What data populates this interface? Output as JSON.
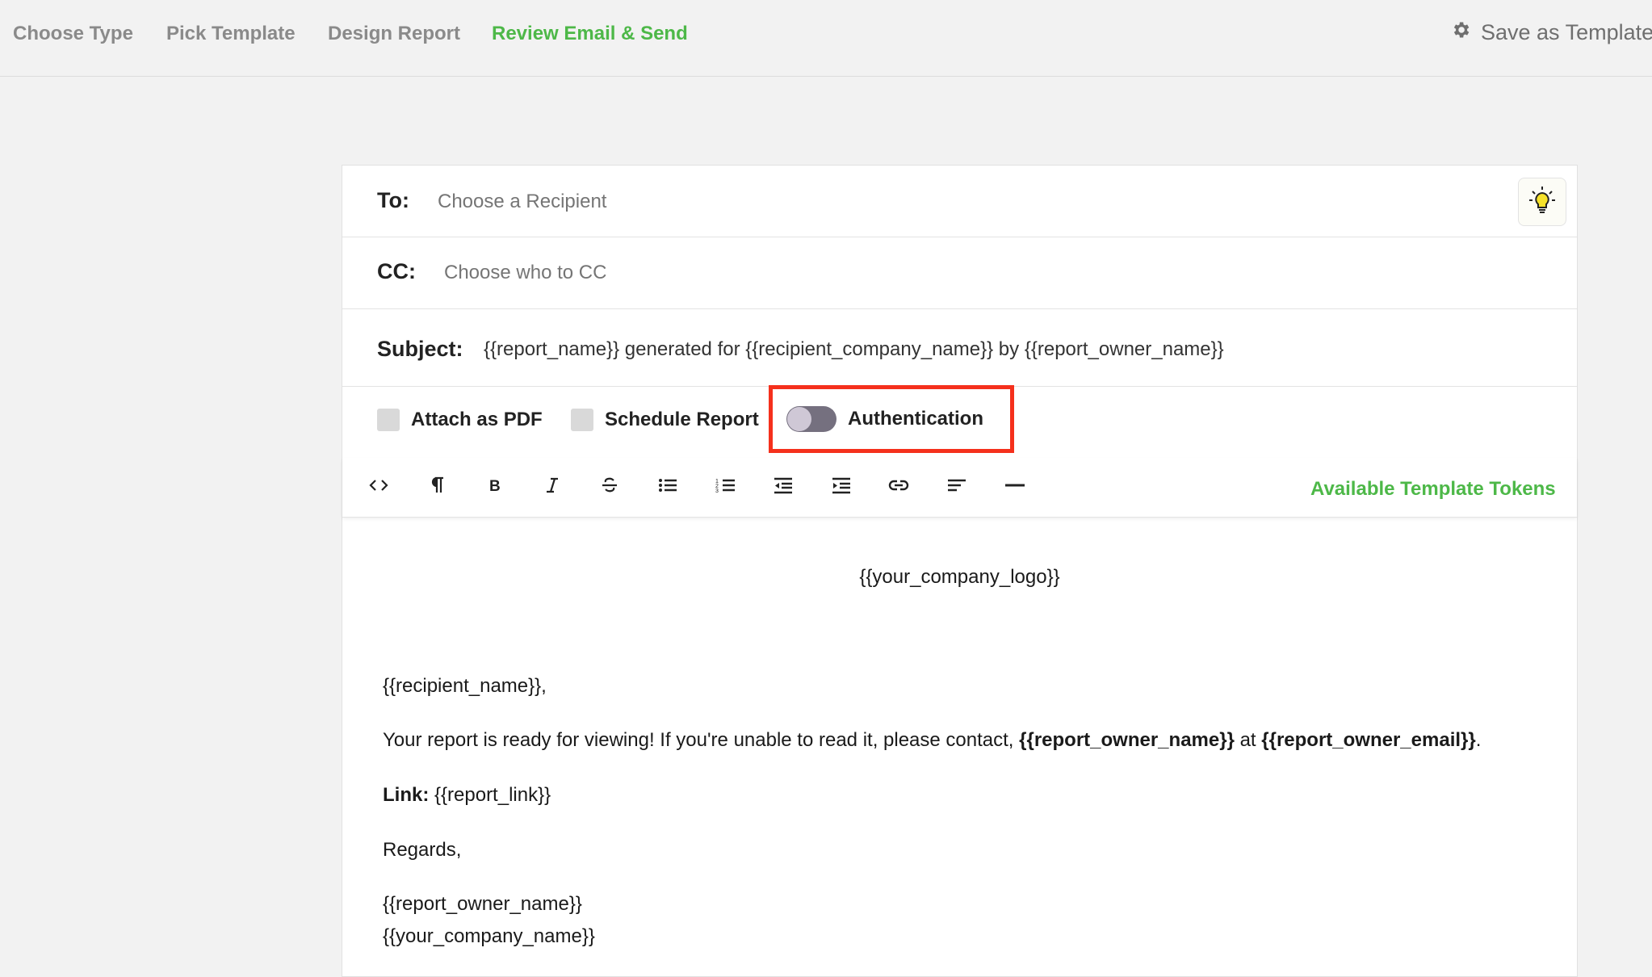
{
  "nav": {
    "steps": [
      {
        "label": "Choose Type"
      },
      {
        "label": "Pick Template"
      },
      {
        "label": "Design Report"
      },
      {
        "label": "Review Email & Send"
      }
    ],
    "active_step": "Review Email & Send",
    "save_template_label": "Save as Template",
    "save_template_icon": "gear-icon"
  },
  "email": {
    "to_label": "To:",
    "to_placeholder": "Choose a Recipient",
    "cc_label": "CC:",
    "cc_placeholder": "Choose who to CC",
    "subject_label": "Subject:",
    "subject_value": "{{report_name}} generated for {{recipient_company_name}} by {{report_owner_name}}",
    "tip_icon": "lightbulb-icon"
  },
  "options": {
    "attach_pdf_label": "Attach as PDF",
    "attach_pdf_checked": false,
    "schedule_label": "Schedule Report",
    "schedule_checked": false,
    "authentication_label": "Authentication",
    "authentication_on": false,
    "highlight_color": "#f5301c"
  },
  "toolbar": {
    "tools": [
      "code-icon",
      "paragraph-icon",
      "bold-icon",
      "italic-icon",
      "strikethrough-icon",
      "bullet-list-icon",
      "numbered-list-icon",
      "outdent-icon",
      "indent-icon",
      "link-icon",
      "align-left-icon",
      "horizontal-rule-icon"
    ],
    "tokens_link_label": "Available Template Tokens"
  },
  "body": {
    "logo_token": "{{your_company_logo}}",
    "greeting": "{{recipient_name}},",
    "message_prefix": "Your report is ready for viewing! If you're unable to read it, please contact, ",
    "owner_name_token": "{{report_owner_name}}",
    "message_at": " at ",
    "owner_email_token": "{{report_owner_email}}",
    "message_suffix": ".",
    "link_label": "Link:",
    "link_token": " {{report_link}}",
    "regards": "Regards,",
    "signature_name": "{{report_owner_name}}",
    "signature_company": "{{your_company_name}}"
  },
  "colors": {
    "accent_green": "#4db848",
    "highlight_red": "#f5301c"
  }
}
